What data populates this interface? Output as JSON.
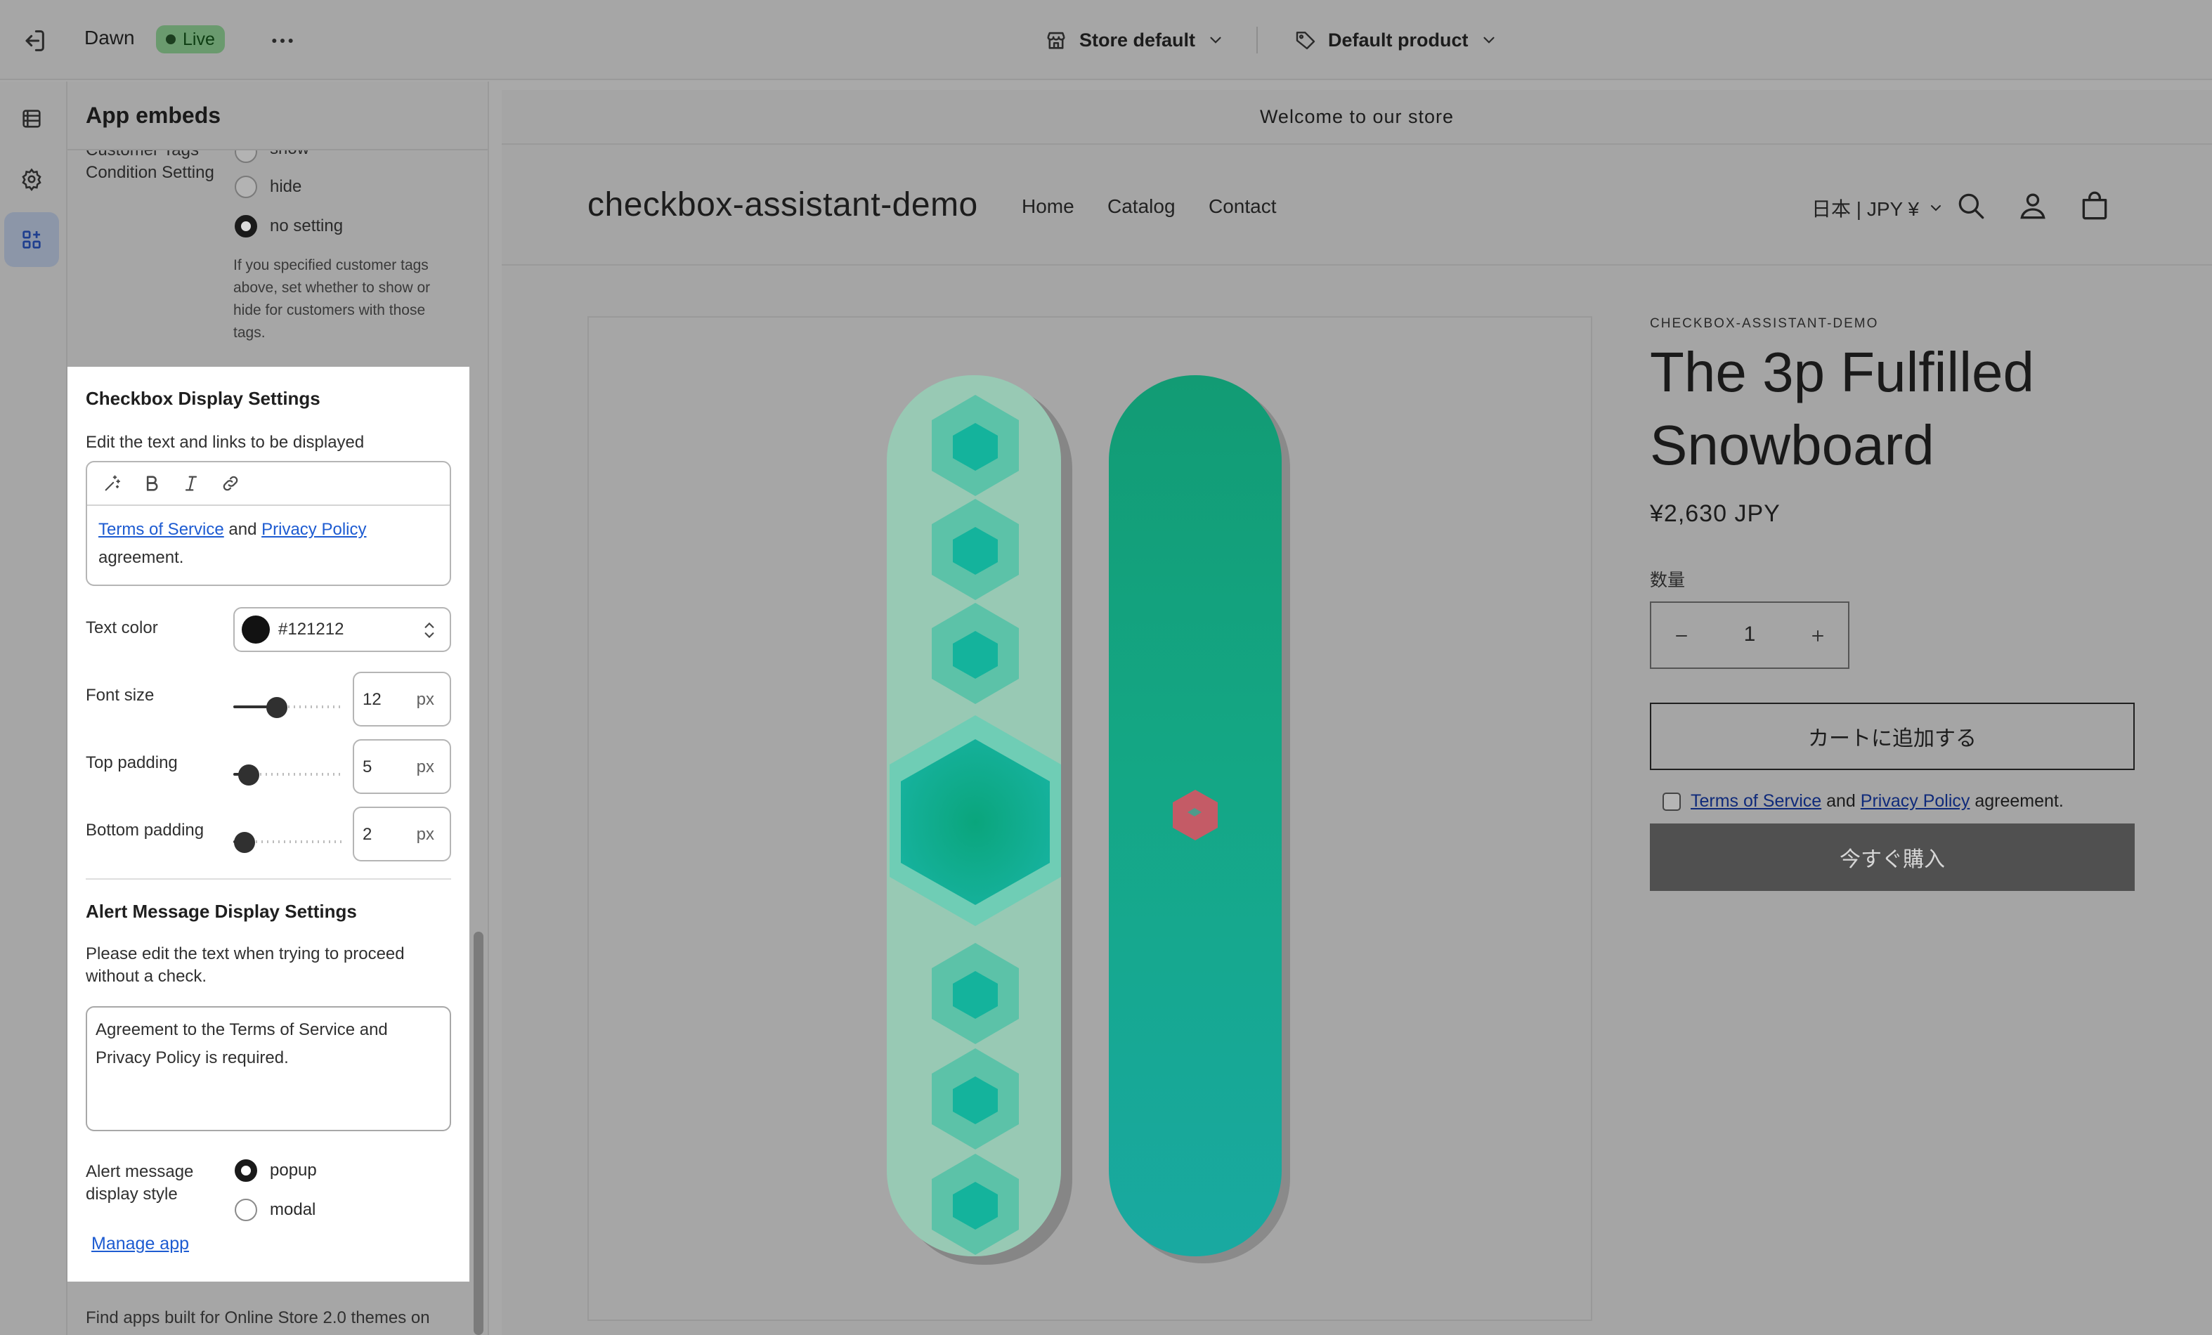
{
  "topbar": {
    "theme_name": "Dawn",
    "live_badge": "Live",
    "store_selector": "Store default",
    "product_selector": "Default product"
  },
  "sidebar": {
    "title": "App embeds",
    "customer_tags": {
      "label_line1": "Customer Tags",
      "label_line2": "Condition Setting",
      "options": [
        "show",
        "hide",
        "no setting"
      ],
      "selected": "no setting",
      "hint": "If you specified customer tags above, set whether to show or hide for customers with those tags."
    },
    "checkbox_display": {
      "heading": "Checkbox Display Settings",
      "editor_label": "Edit the text and links to be displayed",
      "editor_link1": "Terms of Service",
      "editor_and": "and",
      "editor_link2": "Privacy Policy",
      "editor_tail": "agreement.",
      "text_color_label": "Text color",
      "text_color_value": "#121212",
      "font_size_label": "Font size",
      "font_size_value": "12",
      "font_size_fraction": 0.4,
      "top_padding_label": "Top padding",
      "top_padding_value": "5",
      "top_padding_fraction": 0.14,
      "bottom_padding_label": "Bottom padding",
      "bottom_padding_value": "2",
      "bottom_padding_fraction": 0.1,
      "unit": "px"
    },
    "alert_message": {
      "heading": "Alert Message Display Settings",
      "description": "Please edit the text when trying to proceed without a check.",
      "message": "Agreement to the Terms of Service and Privacy Policy is required.",
      "style_label_line1": "Alert message",
      "style_label_line2": "display style",
      "options": [
        "popup",
        "modal"
      ],
      "selected": "popup"
    },
    "manage_app": "Manage app",
    "footer_text": "Find apps built for Online Store 2.0 themes on"
  },
  "preview": {
    "announcement": "Welcome to our store",
    "store_name": "checkbox-assistant-demo",
    "nav": [
      "Home",
      "Catalog",
      "Contact"
    ],
    "locale": "日本 | JPY ¥",
    "brand": "CHECKBOX-ASSISTANT-DEMO",
    "product_title": "The 3p Fulfilled Snowboard",
    "price": "¥2,630 JPY",
    "quantity_label": "数量",
    "quantity": "1",
    "add_to_cart": "カートに追加する",
    "agree_link1": "Terms of Service",
    "agree_and": "and",
    "agree_link2": "Privacy Policy",
    "agree_tail": "agreement.",
    "buy_now": "今すぐ購入"
  },
  "colors": {
    "link": "#1d5bd1",
    "live_badge": "#6a9a6e",
    "snowboard_green": "#13a584",
    "snowboard_mint": "#98c9b4"
  },
  "icons": [
    "exit-icon",
    "more-icon",
    "store-icon",
    "tag-icon",
    "sections-icon",
    "gear-icon",
    "app-embeds-icon",
    "search-icon",
    "account-icon",
    "cart-icon"
  ]
}
